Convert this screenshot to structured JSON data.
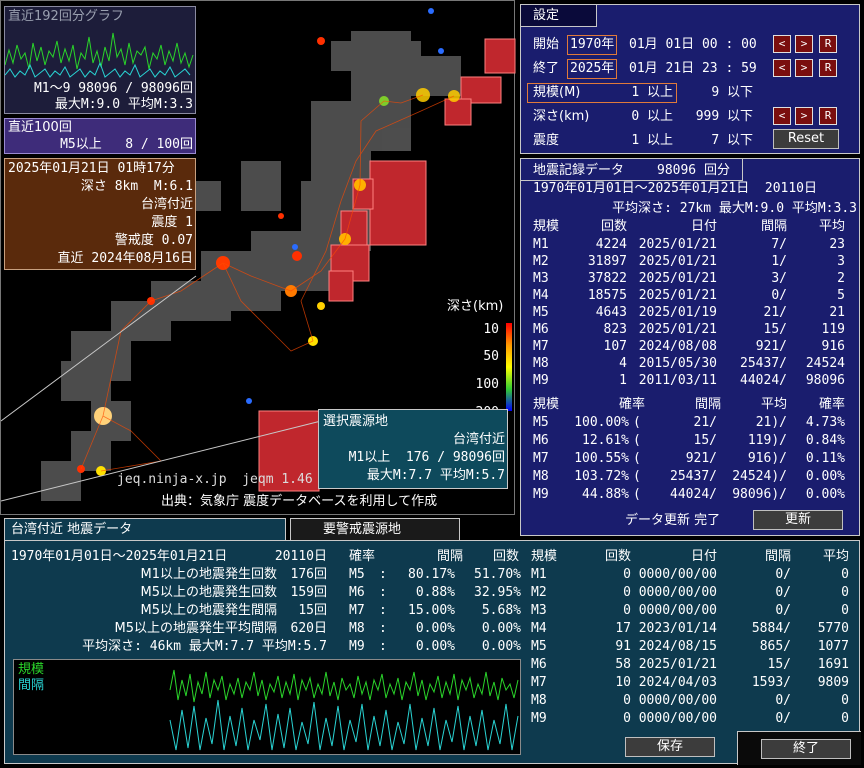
{
  "graph192": {
    "title": "直近192回分グラフ",
    "stat1": "M1〜9 98096 / 98096回",
    "stat2": "最大M:9.0 平均M:3.3"
  },
  "recent100": {
    "title": "直近100回",
    "line": "M5以上   8 / 100回"
  },
  "latest": {
    "datetime": "2025年01月21日 01時17分",
    "depth_mag": "深さ 8km  M:6.1",
    "place": "台湾付近",
    "intensity": "震度 1",
    "alert": "警戒度 0.07",
    "recent": "直近 2024年08月16日"
  },
  "legend": {
    "title": "深さ(km)",
    "ticks": [
      "10",
      "50",
      "100",
      "200"
    ]
  },
  "credit": {
    "site": "jeq.ninja-x.jp  jeqm 1.46",
    "source": "出典：気象庁 震度データベースを利用して作成"
  },
  "selected_source": {
    "title": "選択震源地",
    "place": "台湾付近",
    "count": "M1以上  176 / 98096回",
    "stats": "最大M:7.7 平均M:5.7"
  },
  "settings": {
    "title": "設定",
    "start_label": "開始",
    "start_year": "1970年",
    "start_rest": "01月 01日 00 : 00",
    "end_label": "終了",
    "end_year": "2025年",
    "end_rest": "01月 21日 23 : 59",
    "scale_label": "規模(M)",
    "scale_value": "1 以上",
    "scale_max": "9 以下",
    "depth_label": "深さ(km)",
    "depth_value": "0 以上",
    "depth_max": "999 以下",
    "shindo_label": "震度",
    "shindo_value": "1 以上",
    "shindo_max": "7 以下",
    "reset_label": "Reset",
    "btn_prev": "<",
    "btn_next": ">",
    "btn_r": "R"
  },
  "records": {
    "title": "地震記録データ",
    "count": "98096 回分",
    "range": "1970年01月01日〜2025年01月21日  20110日",
    "avg": "平均深さ: 27km 最大M:9.0 平均M:3.3",
    "headers": [
      "規模",
      "回数",
      "日付",
      "間隔",
      "平均"
    ],
    "rows": [
      [
        "M1",
        "4224",
        "2025/01/21",
        "7/",
        "23"
      ],
      [
        "M2",
        "31897",
        "2025/01/21",
        "1/",
        "3"
      ],
      [
        "M3",
        "37822",
        "2025/01/21",
        "3/",
        "2"
      ],
      [
        "M4",
        "18575",
        "2025/01/21",
        "0/",
        "5"
      ],
      [
        "M5",
        "4643",
        "2025/01/19",
        "21/",
        "21"
      ],
      [
        "M6",
        "823",
        "2025/01/21",
        "15/",
        "119"
      ],
      [
        "M7",
        "107",
        "2024/08/08",
        "921/",
        "916"
      ],
      [
        "M8",
        "4",
        "2015/05/30",
        "25437/",
        "24524"
      ],
      [
        "M9",
        "1",
        "2011/03/11",
        "44024/",
        "98096"
      ]
    ],
    "prob_headers": [
      "規模",
      "確率",
      "間隔",
      "平均",
      "確率"
    ],
    "prob_rows": [
      [
        "M5",
        "100.00%",
        "(",
        "21/",
        "21)/",
        "4.73%"
      ],
      [
        "M6",
        "12.61%",
        "(",
        "15/",
        "119)/",
        "0.84%"
      ],
      [
        "M7",
        "100.55%",
        "(",
        "921/",
        "916)/",
        "0.11%"
      ],
      [
        "M8",
        "103.72%",
        "(",
        "25437/",
        "24524)/",
        "0.00%"
      ],
      [
        "M9",
        "44.88%",
        "(",
        "44024/",
        "98096)/",
        "0.00%"
      ]
    ],
    "update_status": "データ更新 完了",
    "update_button": "更新"
  },
  "tabs": {
    "region_tab": "台湾付近 地震データ",
    "alert_tab": "要警戒震源地"
  },
  "region": {
    "range": "1970年01月01日〜2025年01月21日",
    "days": "20110日",
    "stats": [
      [
        "M1以上の地震発生回数",
        "176回"
      ],
      [
        "M5以上の地震発生回数",
        "159回"
      ],
      [
        "M5以上の地震発生間隔",
        "15回"
      ],
      [
        "M5以上の地震発生平均間隔",
        "620日"
      ]
    ],
    "avg": "平均深さ: 46km 最大M:7.7 平均M:5.7",
    "prob_headers": [
      "確率",
      "間隔",
      "回数"
    ],
    "prob_rows": [
      [
        "M5",
        ":",
        "80.17%",
        "51.70%"
      ],
      [
        "M6",
        ":",
        "0.88%",
        "32.95%"
      ],
      [
        "M7",
        ":",
        "15.00%",
        "5.68%"
      ],
      [
        "M8",
        ":",
        "0.00%",
        "0.00%"
      ],
      [
        "M9",
        ":",
        "0.00%",
        "0.00%"
      ]
    ],
    "graph_labels": [
      "規模",
      "間隔"
    ],
    "table_headers": [
      "規模",
      "回数",
      "日付",
      "間隔",
      "平均"
    ],
    "table_rows": [
      [
        "M1",
        "0",
        "0000/00/00",
        "0/",
        "0"
      ],
      [
        "M2",
        "0",
        "0000/00/00",
        "0/",
        "0"
      ],
      [
        "M3",
        "0",
        "0000/00/00",
        "0/",
        "0"
      ],
      [
        "M4",
        "17",
        "2023/01/14",
        "5884/",
        "5770"
      ],
      [
        "M5",
        "91",
        "2024/08/15",
        "865/",
        "1077"
      ],
      [
        "M6",
        "58",
        "2025/01/21",
        "15/",
        "1691"
      ],
      [
        "M7",
        "10",
        "2024/04/03",
        "1593/",
        "9809"
      ],
      [
        "M8",
        "0",
        "0000/00/00",
        "0/",
        "0"
      ],
      [
        "M9",
        "0",
        "0000/00/00",
        "0/",
        "0"
      ]
    ],
    "save_button": "保存",
    "exit_button": "終了"
  },
  "colors": {
    "navy": "#1a1d6e",
    "teal": "#0e3a4e",
    "brown": "#5a2a0c",
    "purple": "#3e2c7a",
    "hatch": "#c0272d"
  }
}
